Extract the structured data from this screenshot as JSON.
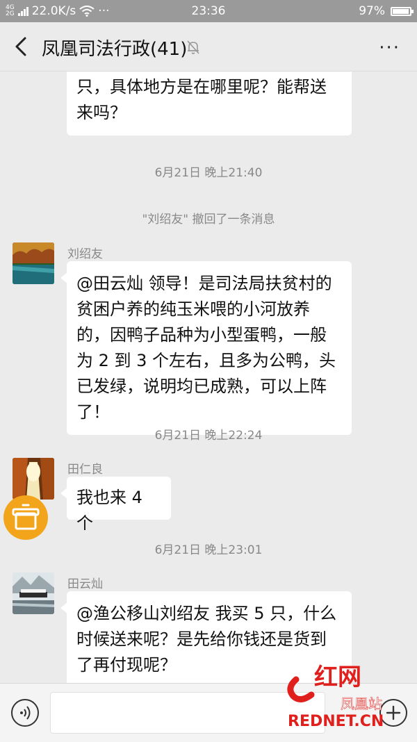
{
  "status_bar": {
    "network_top": "4G",
    "network_bottom": "2G",
    "speed": "22.0K/s",
    "dots": "···",
    "time": "23:36",
    "battery_text": "97%",
    "battery_level": 0.97
  },
  "header": {
    "title": "凤凰司法行政(41)",
    "more": "···"
  },
  "messages": {
    "m0_text": "只，具体地方是在哪里呢？能帮送来吗？",
    "ts1": "6月21日 晚上21:40",
    "recall": "\"刘绍友\" 撤回了一条消息",
    "m1_sender": "刘绍友",
    "m1_text": "@田云灿  领导！是司法局扶贫村的贫困户养的纯玉米喂的小河放养的，因鸭子品种为小型蛋鸭，一般为 2 到 3 个左右，且多为公鸭，头已发绿，说明均已成熟，可以上阵了！",
    "ts2": "6月21日 晚上22:24",
    "m2_sender": "田仁良",
    "m2_text": "我也来 4 个",
    "ts3": "6月21日 晚上23:01",
    "m3_sender": "田云灿",
    "m3_text": "@渔公移山刘绍友  我买 5 只，什么时候送来呢？是先给你钱还是货到了再付现呢？"
  },
  "watermark": {
    "brand": "红网",
    "station": "凤凰站",
    "domain": "REDNET.CN"
  },
  "colors": {
    "background": "#ebebeb",
    "float_button": "#f2a51a",
    "watermark": "#e0201d"
  }
}
